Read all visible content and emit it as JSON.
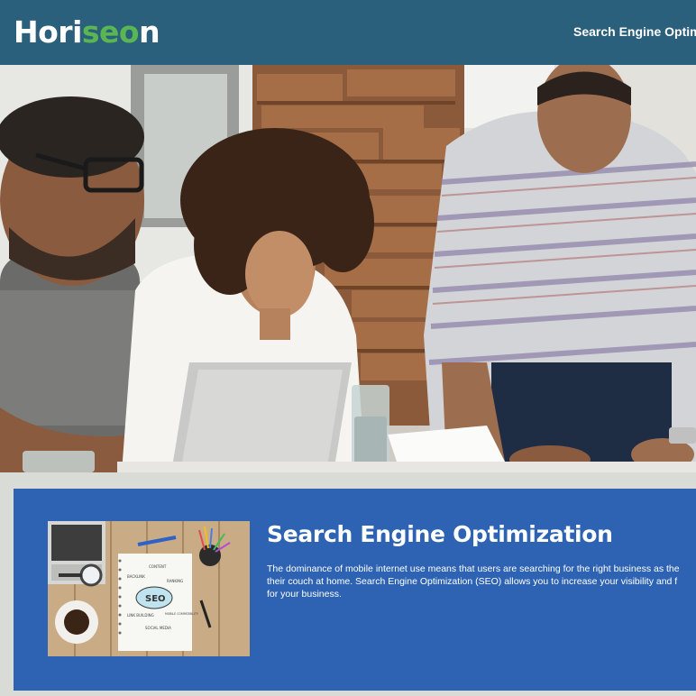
{
  "header": {
    "logo_prefix": "Hori",
    "logo_highlight": "seo",
    "logo_suffix": "n",
    "nav_item": "Search Engine Optimiz",
    "background": "#2a607c",
    "logo_accent": "#5ab553"
  },
  "hero": {
    "image_label": "team-meeting-photo"
  },
  "card": {
    "title": "Search Engine Optimization",
    "body_line1": "The dominance of mobile internet use means that users are searching for the right business as the",
    "body_line2": "their couch at home. Search Engine Optimization (SEO) allows you to increase your visibility and f",
    "body_line3": "for your business.",
    "background": "#2d63b2",
    "thumbnail": {
      "word_seo": "SEO",
      "word_content": "CONTENT",
      "word_backlink": "BACKLINK",
      "word_link_building": "LINK BUILDING",
      "word_social_media": "SOCIAL MEDIA",
      "word_mobile": "MOBILE COMPATIBILITY",
      "word_ranking": "RANKING"
    }
  }
}
